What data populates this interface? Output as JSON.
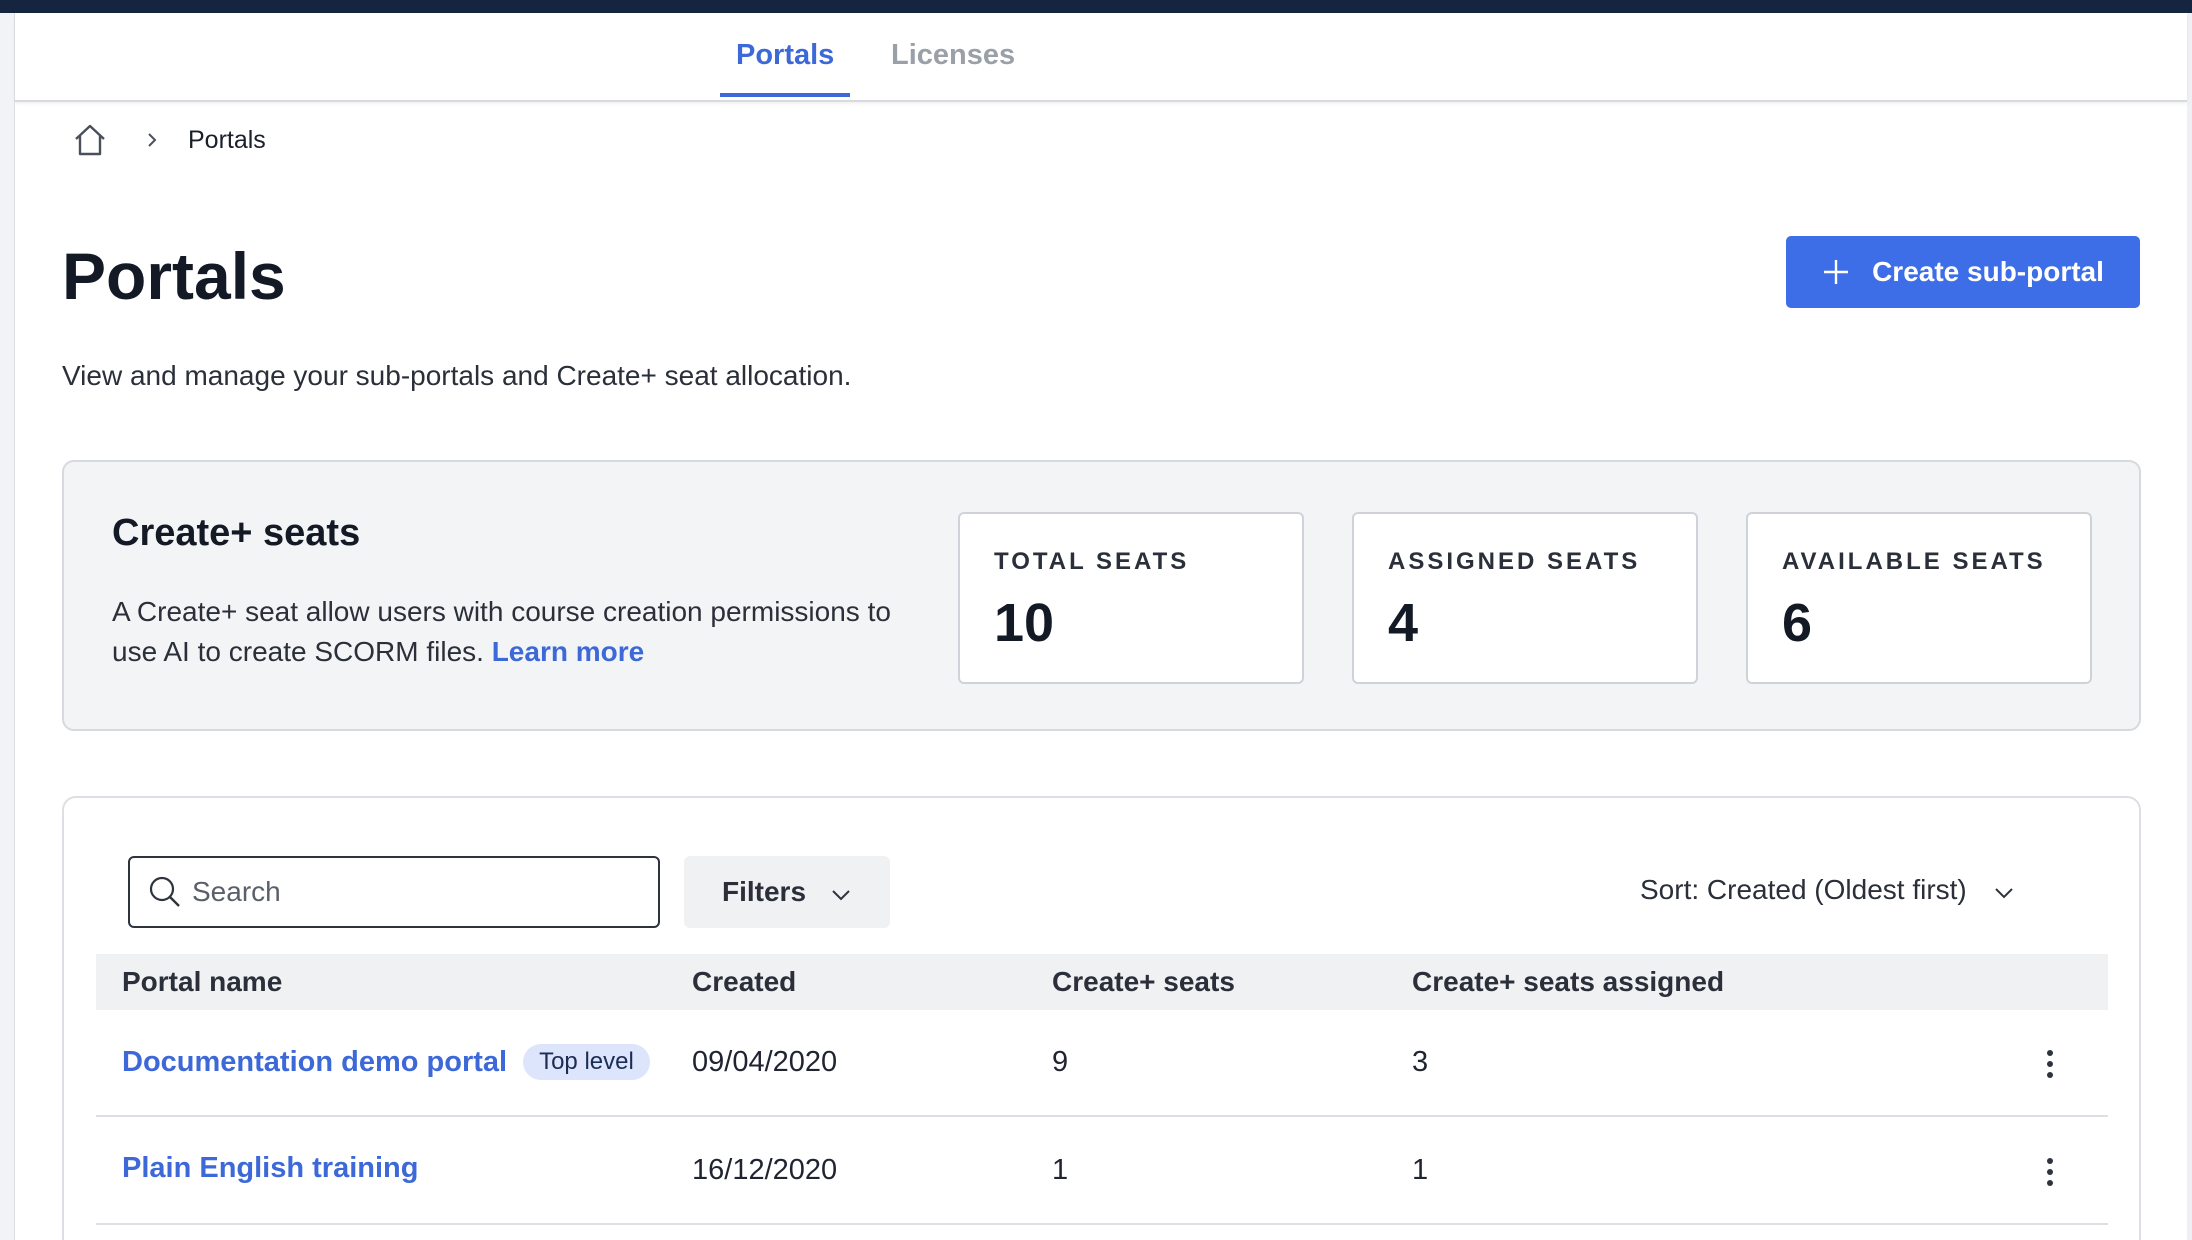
{
  "tabs": [
    {
      "label": "Portals",
      "active": true
    },
    {
      "label": "Licenses",
      "active": false
    }
  ],
  "breadcrumb": {
    "current": "Portals"
  },
  "page": {
    "title": "Portals",
    "subtitle": "View and manage your sub-portals and Create+ seat allocation.",
    "create_button": "Create sub-portal"
  },
  "seats": {
    "title": "Create+ seats",
    "description": "A Create+ seat allow users with course creation permissions to use AI to create SCORM files.",
    "learn_more": "Learn more",
    "stats": [
      {
        "label": "TOTAL SEATS",
        "value": "10"
      },
      {
        "label": "ASSIGNED SEATS",
        "value": "4"
      },
      {
        "label": "AVAILABLE SEATS",
        "value": "6"
      }
    ]
  },
  "toolbar": {
    "search_placeholder": "Search",
    "filters_label": "Filters",
    "sort_label": "Sort: Created (Oldest first)"
  },
  "table": {
    "columns": [
      "Portal name",
      "Created",
      "Create+ seats",
      "Create+ seats assigned"
    ],
    "rows": [
      {
        "name": "Documentation demo portal",
        "badge": "Top level",
        "created": "09/04/2020",
        "seats": "9",
        "assigned": "3"
      },
      {
        "name": "Plain English training",
        "badge": "",
        "created": "16/12/2020",
        "seats": "1",
        "assigned": "1"
      }
    ]
  },
  "colors": {
    "accent": "#3d69d8",
    "button": "#3d6ee8",
    "topbar": "#15243f"
  }
}
